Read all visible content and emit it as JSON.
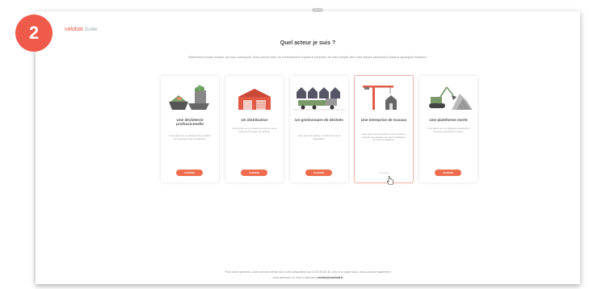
{
  "badge": "2",
  "logo": {
    "main": "valobat",
    "sub": "Guide"
  },
  "title": "Quel acteur je suis ?",
  "subtitle": "Déterminez la base d'acteur qui vous correspond. Vous pourrez bien, en conformément d'après le périmètre de votre compte faire votre espace personnel à d'autres typologies d'acteurs !",
  "cards": [
    {
      "title": "Une déchèterie professionnelle",
      "desc": "Vous gérez un ou plusieurs sites dédiés aux professionnels du bâtiment.",
      "action": "CHOISIR"
    },
    {
      "title": "Un distributeur",
      "desc": "Vous gérez un ou plusieurs points de vente assurant la reprise de déchets.",
      "action": "CHOISIR"
    },
    {
      "title": "Un gestionnaire de déchets",
      "desc": "Vous gérez la collecte, le traitement ou la valorisation.",
      "action": "CHOISIR"
    },
    {
      "title": "Une entreprise de travaux",
      "desc": "Vous gérez des chantiers et êtes amené à évacuer vos déchets vers des installations de collecte adaptées.",
      "action": "CHOISIR"
    },
    {
      "title": "Une plateforme inerte",
      "desc": "Vous gérez une ou plusieurs plateformes recevant des déchets inertes.",
      "action": "CHOISIR"
    }
  ],
  "footer": {
    "line1": "Pour toute question, notre service clients est à votre disposition au 01 80 83 80 10, prix d'un appel local. Vous pouvez également",
    "line2_prefix": "nous adresser un mail à l'adresse",
    "email": "contact@valobat.fr"
  },
  "colors": {
    "accent": "#f05a4a",
    "button": "#ef6d4f"
  },
  "icons": [
    "skip-bins-illustration",
    "warehouse-illustration",
    "waste-truck-illustration",
    "crane-illustration",
    "excavator-illustration",
    "pointer-cursor-icon"
  ]
}
